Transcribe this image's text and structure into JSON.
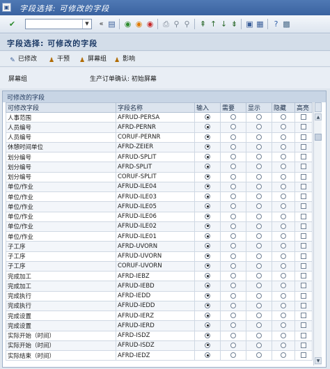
{
  "window": {
    "title": "字段选择: 可修改的字段"
  },
  "toolbar": {
    "command_value": ""
  },
  "page": {
    "title": "字段选择: 可修改的字段"
  },
  "app_toolbar": {
    "modified_label": "已修改",
    "intervene_label": "干预",
    "screen_group_label": "屏幕组",
    "effect_label": "影响"
  },
  "info": {
    "screen_group_label": "屏幕组",
    "confirmation_label": "生产订单确认: 初始屏幕"
  },
  "group": {
    "title": "可修改的字段"
  },
  "table": {
    "columns": [
      "可修改字段",
      "字段名称",
      "输入",
      "需要",
      "显示",
      "隐藏",
      "高亮"
    ],
    "rows": [
      {
        "label": "人事范围",
        "field": "AFRUD-PERSA",
        "sel": 0
      },
      {
        "label": "人员编号",
        "field": "AFRD-PERNR",
        "sel": 0
      },
      {
        "label": "人员编号",
        "field": "CORUF-PERNR",
        "sel": 0
      },
      {
        "label": "休憩时间单位",
        "field": "AFRD-ZEIER",
        "sel": 0
      },
      {
        "label": "划分编号",
        "field": "AFRUD-SPLIT",
        "sel": 0
      },
      {
        "label": "划分编号",
        "field": "AFRD-SPLIT",
        "sel": 0
      },
      {
        "label": "划分编号",
        "field": "CORUF-SPLIT",
        "sel": 0
      },
      {
        "label": "单位/作业",
        "field": "AFRUD-ILE04",
        "sel": 0
      },
      {
        "label": "单位/作业",
        "field": "AFRUD-ILE03",
        "sel": 0
      },
      {
        "label": "单位/作业",
        "field": "AFRUD-ILE05",
        "sel": 0
      },
      {
        "label": "单位/作业",
        "field": "AFRUD-ILE06",
        "sel": 0
      },
      {
        "label": "单位/作业",
        "field": "AFRUD-ILE02",
        "sel": 0
      },
      {
        "label": "单位/作业",
        "field": "AFRUD-ILE01",
        "sel": 0
      },
      {
        "label": "子工序",
        "field": "AFRD-UVORN",
        "sel": 0
      },
      {
        "label": "子工序",
        "field": "AFRUD-UVORN",
        "sel": 0
      },
      {
        "label": "子工序",
        "field": "CORUF-UVORN",
        "sel": 0
      },
      {
        "label": "完成加工",
        "field": "AFRD-IEBZ",
        "sel": 0
      },
      {
        "label": "完成加工",
        "field": "AFRUD-IEBD",
        "sel": 0
      },
      {
        "label": "完成执行",
        "field": "AFRD-IEDD",
        "sel": 0
      },
      {
        "label": "完成执行",
        "field": "AFRUD-IEDD",
        "sel": 0
      },
      {
        "label": "完成设置",
        "field": "AFRUD-IERZ",
        "sel": 0
      },
      {
        "label": "完成设置",
        "field": "AFRUD-IERD",
        "sel": 0
      },
      {
        "label": "实际开始（时间）",
        "field": "AFRD-ISDZ",
        "sel": 0
      },
      {
        "label": "实际开始（时间）",
        "field": "AFRUD-ISDZ",
        "sel": 0
      },
      {
        "label": "实际结束（时间）",
        "field": "AFRD-IEDZ",
        "sel": 0
      }
    ]
  }
}
